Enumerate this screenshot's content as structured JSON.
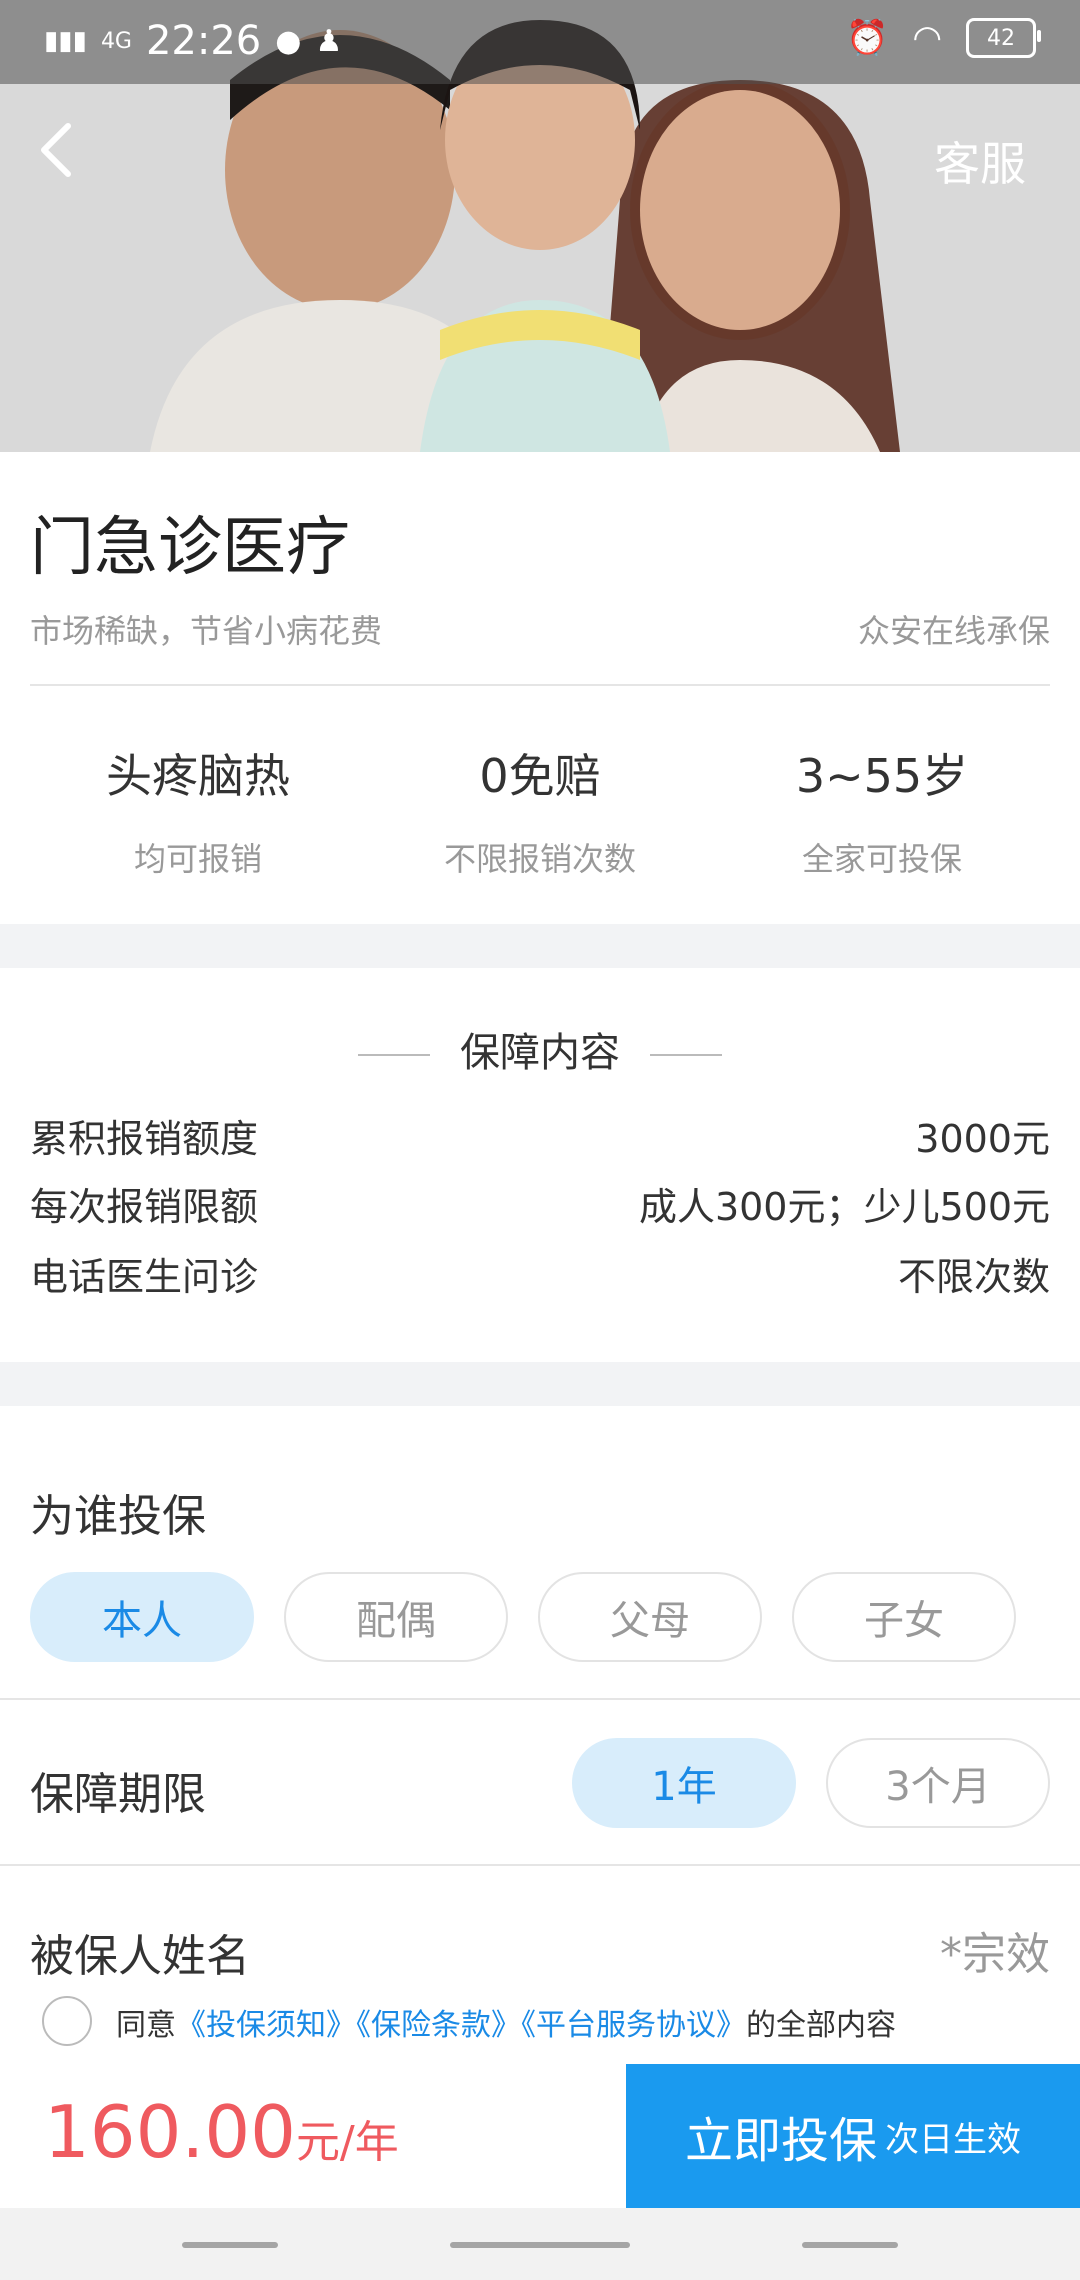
{
  "status_bar": {
    "network": "4G",
    "time": "22:26",
    "battery": "42"
  },
  "header": {
    "back_icon": "chevron-left-icon",
    "service_label": "客服"
  },
  "product": {
    "title": "门急诊医疗",
    "tagline": "市场稀缺，节省小病花费",
    "insurer": "众安在线承保",
    "features": [
      {
        "value": "头疼脑热",
        "label": "均可报销"
      },
      {
        "value": "0免赔",
        "label": "不限报销次数"
      },
      {
        "value": "3~55岁",
        "label": "全家可投保"
      }
    ]
  },
  "coverage": {
    "heading": "保障内容",
    "rows": [
      {
        "name": "累积报销额度",
        "value": "3000元"
      },
      {
        "name": "每次报销限额",
        "value": "成人300元；少儿500元"
      },
      {
        "name": "电话医生问诊",
        "value": "不限次数"
      }
    ]
  },
  "insure_for": {
    "label": "为谁投保",
    "options": [
      "本人",
      "配偶",
      "父母",
      "子女"
    ],
    "selected": "本人"
  },
  "period": {
    "label": "保障期限",
    "options": [
      "1年",
      "3个月"
    ],
    "selected": "1年"
  },
  "insured_name": {
    "label": "被保人姓名",
    "value": "*宗效"
  },
  "agreement": {
    "prefix": "同意",
    "links": [
      "《投保须知》",
      "《保险条款》",
      "《平台服务协议》"
    ],
    "suffix": "的全部内容"
  },
  "footer": {
    "price": "160.00",
    "unit": "元/年",
    "buy_label": "立即投保",
    "buy_note": "次日生效"
  },
  "colors": {
    "accent": "#1a9aef",
    "price": "#ef5a5f",
    "selected_bg": "#d8edfb"
  }
}
